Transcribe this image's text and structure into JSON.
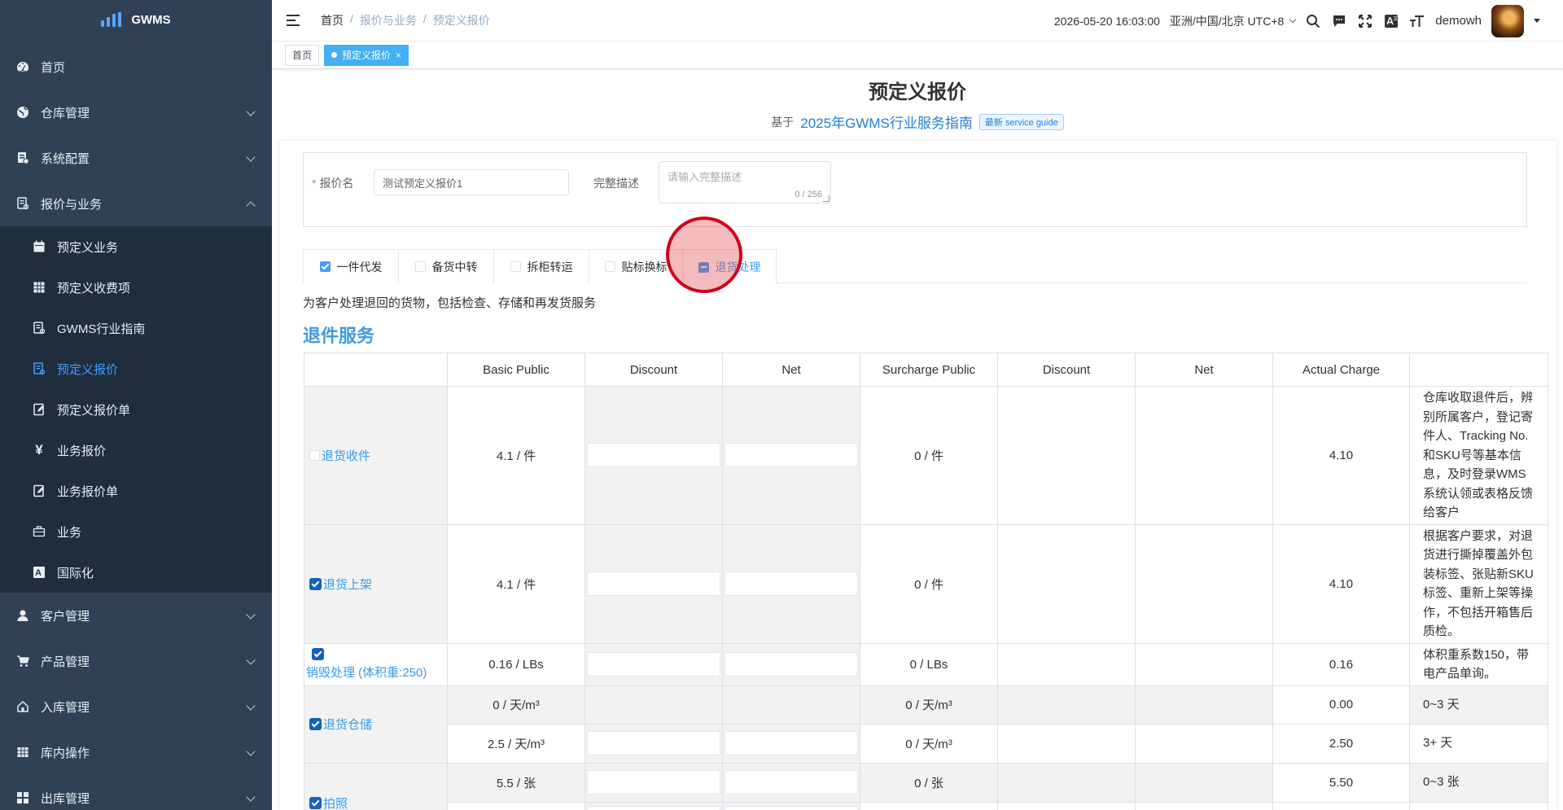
{
  "app": {
    "logo_text": "GWMS"
  },
  "sidebar": {
    "items": [
      {
        "label": "首页",
        "icon": "dashboard-icon",
        "expandable": false
      },
      {
        "label": "仓库管理",
        "icon": "globe-icon",
        "expandable": true
      },
      {
        "label": "系统配置",
        "icon": "settings-doc-icon",
        "expandable": true
      },
      {
        "label": "报价与业务",
        "icon": "quote-doc-icon",
        "expandable": true,
        "expanded": true
      }
    ],
    "sub_items": [
      {
        "label": "预定义业务",
        "icon": "calendar-icon"
      },
      {
        "label": "预定义收费项",
        "icon": "table-icon"
      },
      {
        "label": "GWMS行业指南",
        "icon": "guide-doc-icon"
      },
      {
        "label": "预定义报价",
        "icon": "quote-doc-icon",
        "active": true
      },
      {
        "label": "预定义报价单",
        "icon": "edit-doc-icon"
      },
      {
        "label": "业务报价",
        "icon": "yen-icon"
      },
      {
        "label": "业务报价单",
        "icon": "edit-doc-icon"
      },
      {
        "label": "业务",
        "icon": "briefcase-icon"
      },
      {
        "label": "国际化",
        "icon": "translate-icon"
      }
    ],
    "items_after": [
      {
        "label": "客户管理",
        "icon": "user-icon"
      },
      {
        "label": "产品管理",
        "icon": "cart-icon"
      },
      {
        "label": "入库管理",
        "icon": "home-in-icon"
      },
      {
        "label": "库内操作",
        "icon": "grid-icon"
      },
      {
        "label": "出库管理",
        "icon": "apps-icon"
      }
    ]
  },
  "header": {
    "breadcrumb": [
      "首页",
      "报价与业务",
      "预定义报价"
    ],
    "datetime": "2026-05-20 16:03:00",
    "timezone": "亚洲/中国/北京 UTC+8",
    "username": "demowh"
  },
  "tags_view": {
    "tags": [
      "首页",
      "预定义报价"
    ],
    "close_symbol": "×"
  },
  "page": {
    "title": "预定义报价",
    "based_on_prefix": "基于",
    "guide_link": "2025年GWMS行业服务指南",
    "guide_badge": "最新 service guide"
  },
  "form": {
    "name_label": "报价名",
    "name_value": "测试预定义报价1",
    "desc_label": "完整描述",
    "desc_placeholder": "请输入完整描述",
    "desc_count": "0 / 256"
  },
  "tabs": [
    {
      "label": "一件代发",
      "state": "checked"
    },
    {
      "label": "备货中转",
      "state": "unchecked"
    },
    {
      "label": "拆柜转运",
      "state": "unchecked"
    },
    {
      "label": "贴标换标",
      "state": "unchecked"
    },
    {
      "label": "退货处理",
      "state": "indeterminate",
      "active": true
    }
  ],
  "tab_description": "为客户处理退回的货物，包括检查、存储和再发货服务",
  "section_title": "退件服务",
  "table": {
    "headers": [
      "",
      "Basic Public",
      "Discount",
      "Net",
      "Surcharge Public",
      "Discount",
      "Net",
      "Actual Charge",
      ""
    ],
    "rows": [
      {
        "name": "退货收件",
        "checked": false,
        "basic": "4.1 / 件",
        "surcharge": "0 / 件",
        "actual": "4.10",
        "note": "仓库收取退件后，辨别所属客户，登记寄件人、Tracking No.和SKU号等基本信息，及时登录WMS系统认领或表格反馈给客户"
      },
      {
        "name": "退货上架",
        "checked": true,
        "basic": "4.1 / 件",
        "surcharge": "0 / 件",
        "actual": "4.10",
        "note": "根据客户要求，对退货进行撕掉覆盖外包装标签、张贴新SKU标签、重新上架等操作，不包括开箱售后质检。"
      },
      {
        "name": "销毁处理 (体积重:250)",
        "checked": true,
        "basic": "0.16 / LBs",
        "surcharge": "0 / LBs",
        "actual": "0.16",
        "note": "体积重系数150，带电产品单询。"
      },
      {
        "name": "退货仓储",
        "checked": true,
        "tiers": [
          {
            "basic": "0 / 天/m³",
            "surcharge": "0 / 天/m³",
            "actual": "0.00",
            "note": "0~3 天"
          },
          {
            "basic": "2.5 / 天/m³",
            "surcharge": "0 / 天/m³",
            "actual": "2.50",
            "note": "3+ 天"
          }
        ]
      },
      {
        "name": "拍照",
        "checked": true,
        "tiers": [
          {
            "basic": "5.5 / 张",
            "surcharge": "0 / 张",
            "actual": "5.50",
            "note": "0~3 张"
          }
        ]
      }
    ]
  }
}
